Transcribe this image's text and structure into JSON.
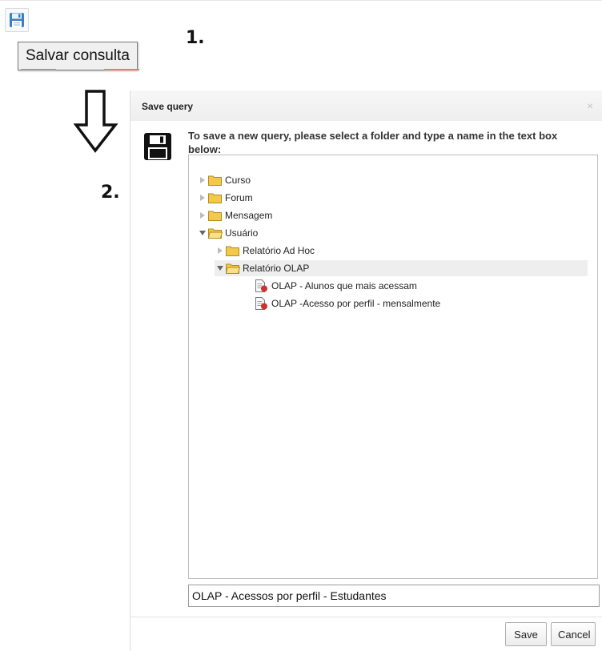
{
  "steps": {
    "first": "1.",
    "second": "2."
  },
  "toolbar": {
    "save_icon": "floppy-disk-icon",
    "tooltip": "Salvar consulta"
  },
  "dialog": {
    "title": "Save query",
    "close_symbol": "×",
    "message": "To save a new query, please select a folder and type a name in the text box below:",
    "icon": "floppy-disk-icon",
    "tree": [
      {
        "label": "Curso",
        "type": "folder",
        "expanded": false
      },
      {
        "label": "Forum",
        "type": "folder",
        "expanded": false
      },
      {
        "label": "Mensagem",
        "type": "folder",
        "expanded": false
      },
      {
        "label": "Usuário",
        "type": "folder",
        "expanded": true,
        "children": [
          {
            "label": "Relatório Ad Hoc",
            "type": "folder",
            "expanded": false
          },
          {
            "label": "Relatório OLAP",
            "type": "folder",
            "expanded": true,
            "selected": true,
            "children": [
              {
                "label": "OLAP - Alunos que mais acessam",
                "type": "report"
              },
              {
                "label": "OLAP -Acesso por perfil - mensalmente",
                "type": "report"
              }
            ]
          }
        ]
      }
    ],
    "query_name_value": "OLAP - Acessos por perfil - Estudantes",
    "save_label": "Save",
    "cancel_label": "Cancel"
  },
  "colors": {
    "folder": "#f2c94c",
    "report_badge": "#d32f2f",
    "selected_row": "#eeeeee"
  }
}
